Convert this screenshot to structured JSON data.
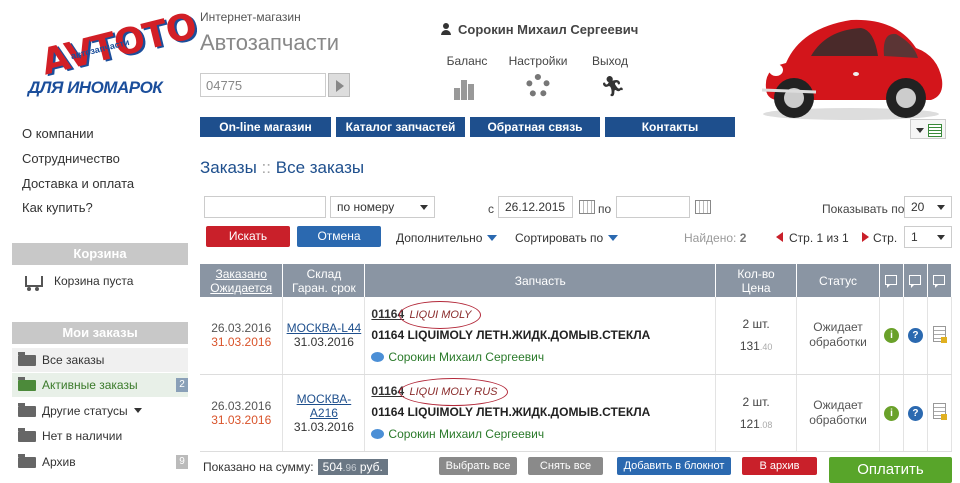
{
  "logo": {
    "top": "AVTOTO",
    "mid": "автозапчасти",
    "bottom": "ДЛЯ ИНОМАРОК"
  },
  "header": {
    "shop_label": "Интернет-магазин",
    "shop_title": "Автозапчасти",
    "search_value": "04775",
    "user_name": "Сорокин Михаил Сергеевич",
    "links": {
      "balance": "Баланс",
      "settings": "Настройки",
      "logout": "Выход"
    }
  },
  "nav": [
    "On-line магазин",
    "Каталог запчастей",
    "Обратная связь",
    "Контакты"
  ],
  "left_menu": [
    "О компании",
    "Сотрудничество",
    "Доставка и оплата",
    "Как купить?"
  ],
  "cart": {
    "title": "Корзина",
    "status": "Корзина пуста"
  },
  "orders_menu": {
    "title": "Мои заказы",
    "items": [
      {
        "label": "Все заказы",
        "count": ""
      },
      {
        "label": "Активные заказы",
        "count": "2"
      },
      {
        "label": "Другие статусы",
        "count": ""
      },
      {
        "label": "Нет в наличии",
        "count": ""
      },
      {
        "label": "Архив",
        "count": "9"
      }
    ]
  },
  "page": {
    "title_a": "Заказы",
    "sep": "::",
    "title_b": "Все заказы"
  },
  "filters": {
    "text_value": "",
    "mode": "по номеру",
    "from_label": "с",
    "from_date": "26.12.2015",
    "to_label": "по",
    "to_date": "",
    "show_label": "Показывать по",
    "show_value": "20",
    "search_btn": "Искать",
    "cancel_btn": "Отмена",
    "more": "Дополнительно",
    "sort": "Сортировать по",
    "found_label": "Найдено:",
    "found_value": "2",
    "page_text": "Стр. 1 из 1",
    "page_label": "Стр.",
    "page_value": "1"
  },
  "table": {
    "headers": {
      "ordered": "Заказано",
      "expected": "Ожидается",
      "warehouse": "Склад",
      "warranty": "Гаран. срок",
      "part": "Запчасть",
      "qty": "Кол-во",
      "price": "Цена",
      "status": "Статус"
    },
    "rows": [
      {
        "date1": "26.03.2016",
        "date2": "31.03.2016",
        "wh": "МОСКВА-L44",
        "wh_date": "31.03.2016",
        "code": "01164",
        "brand": "LIQUI MOLY",
        "name": "01164 LIQUIMOLY ЛЕТН.ЖИДК.ДОМЫВ.СТЕКЛА",
        "user": "Сорокин Михаил Сергеевич",
        "qty": "2 шт.",
        "price": "131",
        "cents": ".40",
        "status1": "Ожидает",
        "status2": "обработки"
      },
      {
        "date1": "26.03.2016",
        "date2": "31.03.2016",
        "wh": "МОСКВА-А216",
        "wh_date": "31.03.2016",
        "code": "01164",
        "brand": "LIQUI MOLY RUS",
        "name": "01164 LIQUIMOLY ЛЕТН.ЖИДК.ДОМЫВ.СТЕКЛА",
        "user": "Сорокин Михаил Сергеевич",
        "qty": "2 шт.",
        "price": "121",
        "cents": ".08",
        "status1": "Ожидает",
        "status2": "обработки"
      }
    ]
  },
  "footer": {
    "sum_label": "Показано на сумму:",
    "sum_value": "504",
    "sum_cents": ".96",
    "sum_currency": "руб.",
    "select_all": "Выбрать все",
    "deselect_all": "Снять все",
    "to_notebook": "Добавить в блокнот",
    "to_archive": "В архив",
    "pay": "Оплатить"
  },
  "colors": {
    "nav": "#1e4f8d",
    "red": "#c9202a",
    "green": "#58a52a",
    "header_row": "#8a95a3"
  },
  "icons": [
    "user-icon",
    "balance-bars-icon",
    "gear-icon",
    "runner-icon",
    "cart-icon",
    "folder-icon",
    "calendar-icon",
    "info-icon",
    "question-icon",
    "document-icon",
    "comment-icon"
  ]
}
